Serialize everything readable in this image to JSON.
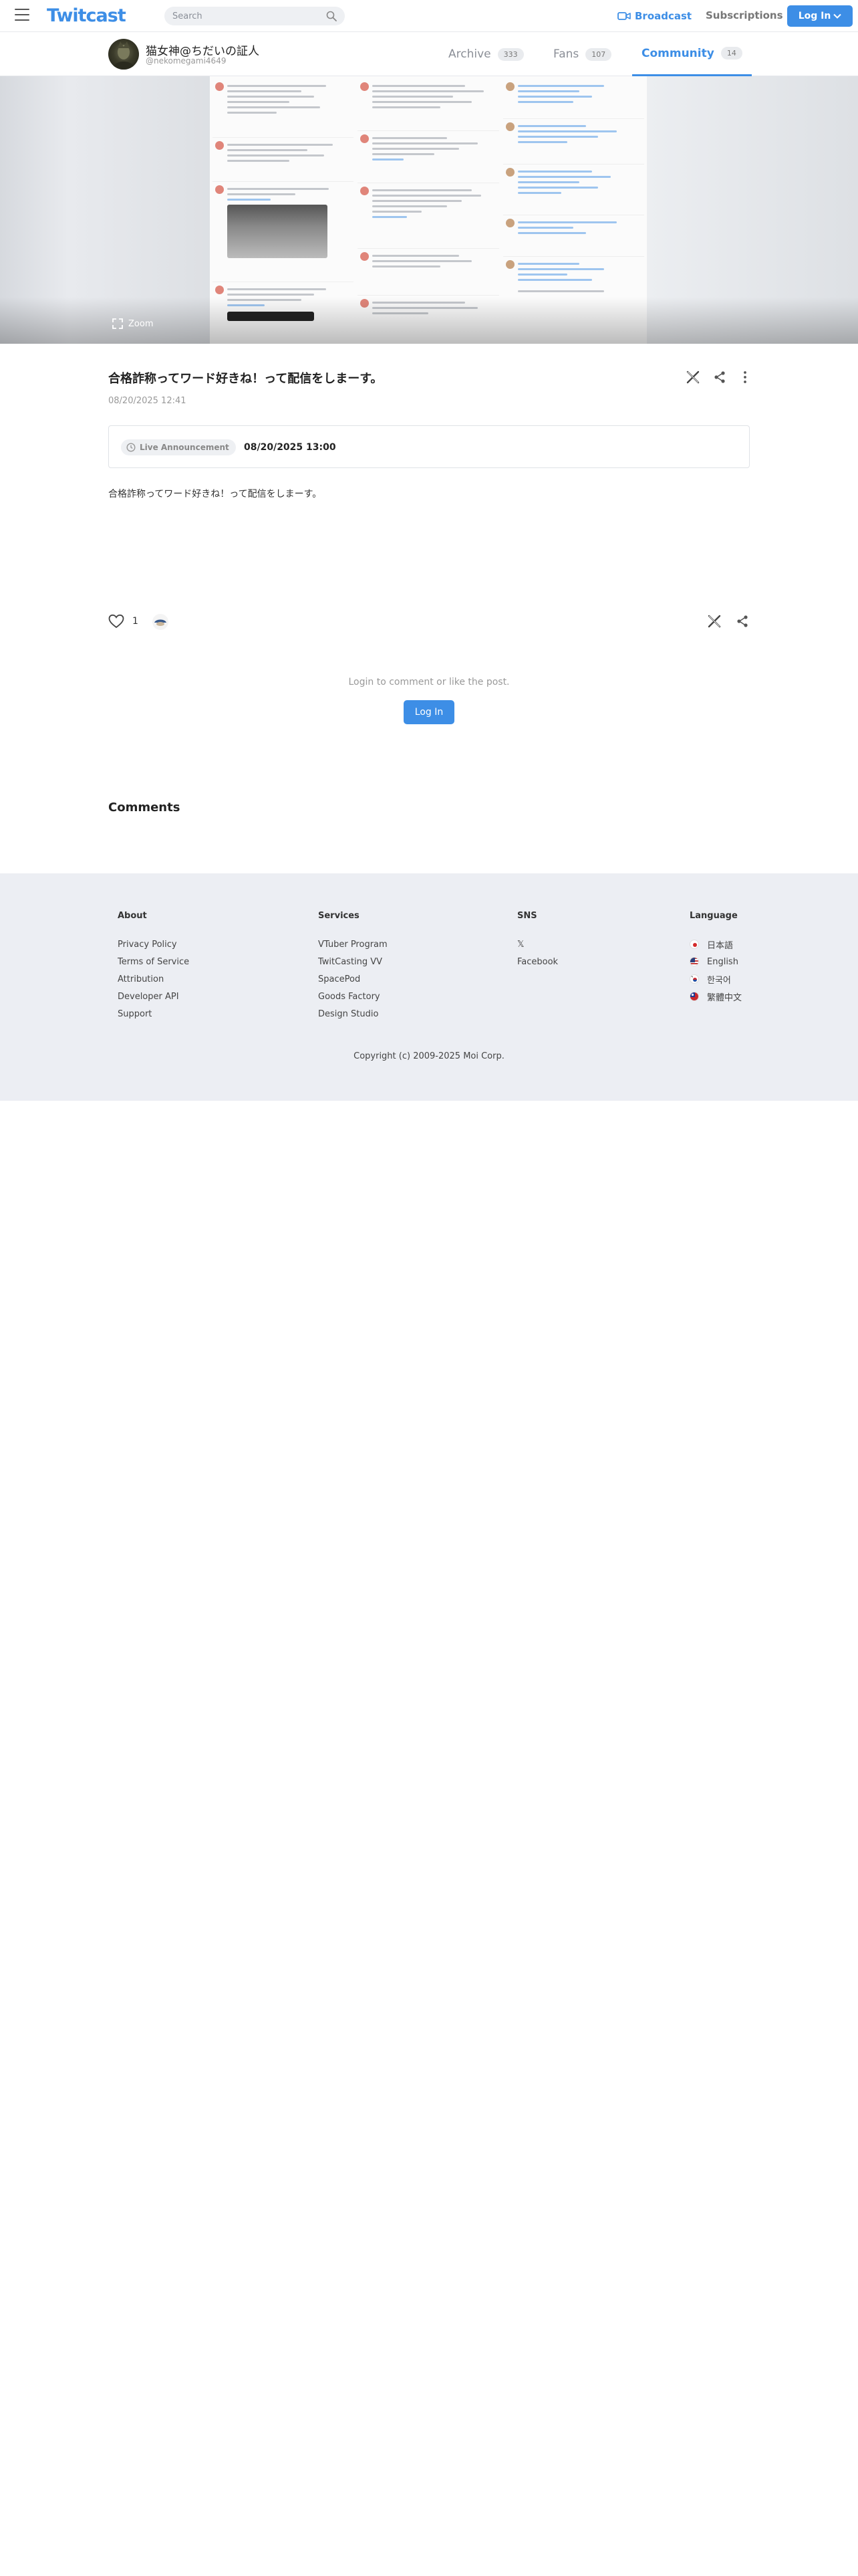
{
  "header": {
    "logo": "Twitcast",
    "search_placeholder": "Search",
    "broadcast_label": "Broadcast",
    "subscriptions_label": "Subscriptions",
    "login_label": "Log In"
  },
  "user": {
    "display_name": "猫女神@ちだいの証人",
    "handle": "@nekomegami4649"
  },
  "tabs": [
    {
      "label": "Archive",
      "count": "333"
    },
    {
      "label": "Fans",
      "count": "107"
    },
    {
      "label": "Community",
      "count": "14",
      "active": true
    }
  ],
  "hero": {
    "zoom_label": "Zoom"
  },
  "post": {
    "title": "合格詐称ってワード好きね！って配信をしまーす。",
    "date": "08/20/2025 12:41",
    "live_badge": "Live Announcement",
    "live_datetime": "08/20/2025 13:00",
    "body": "合格詐称ってワード好きね！って配信をしまーす。",
    "like_count": "1"
  },
  "login_prompt": {
    "text": "Login to comment or like the post.",
    "button": "Log In"
  },
  "comments_heading": "Comments",
  "footer": {
    "about": {
      "heading": "About",
      "links": [
        "Privacy Policy",
        "Terms of Service",
        "Attribution",
        "Developer API",
        "Support"
      ]
    },
    "services": {
      "heading": "Services",
      "links": [
        "VTuber Program",
        "TwitCasting VV",
        "SpacePod",
        "Goods Factory",
        "Design Studio"
      ]
    },
    "sns": {
      "heading": "SNS",
      "links": [
        "𝕏",
        "Facebook"
      ]
    },
    "language": {
      "heading": "Language",
      "items": [
        "日本語",
        "English",
        "한국어",
        "繁體中文"
      ]
    },
    "copyright": "Copyright (c) 2009-2025 Moi Corp."
  },
  "colors": {
    "accent": "#3d8ee6",
    "footer_bg": "#eceef3"
  }
}
